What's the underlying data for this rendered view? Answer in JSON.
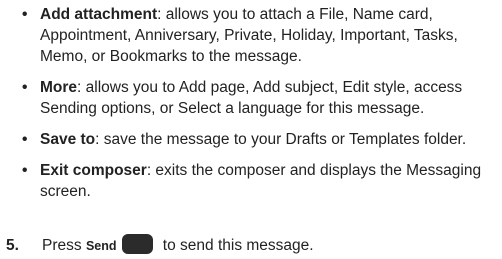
{
  "bullets": [
    {
      "term": "Add attachment",
      "text": ": allows you to attach a File, Name card, Appointment, Anniversary, Private, Holiday, Important, Tasks, Memo, or Bookmarks to the message."
    },
    {
      "term": "More",
      "text": ": allows you to Add page, Add subject, Edit style, access Sending options, or Select a language for this message."
    },
    {
      "term": "Save to",
      "text": ": save the message to your Drafts or Templates folder."
    },
    {
      "term": "Exit composer",
      "text": ": exits the composer and displays the Messaging screen."
    }
  ],
  "bullet_symbol": "•",
  "step": {
    "number": "5.",
    "prefix": "Press ",
    "key_label": "Send",
    "suffix": " to send this message."
  }
}
